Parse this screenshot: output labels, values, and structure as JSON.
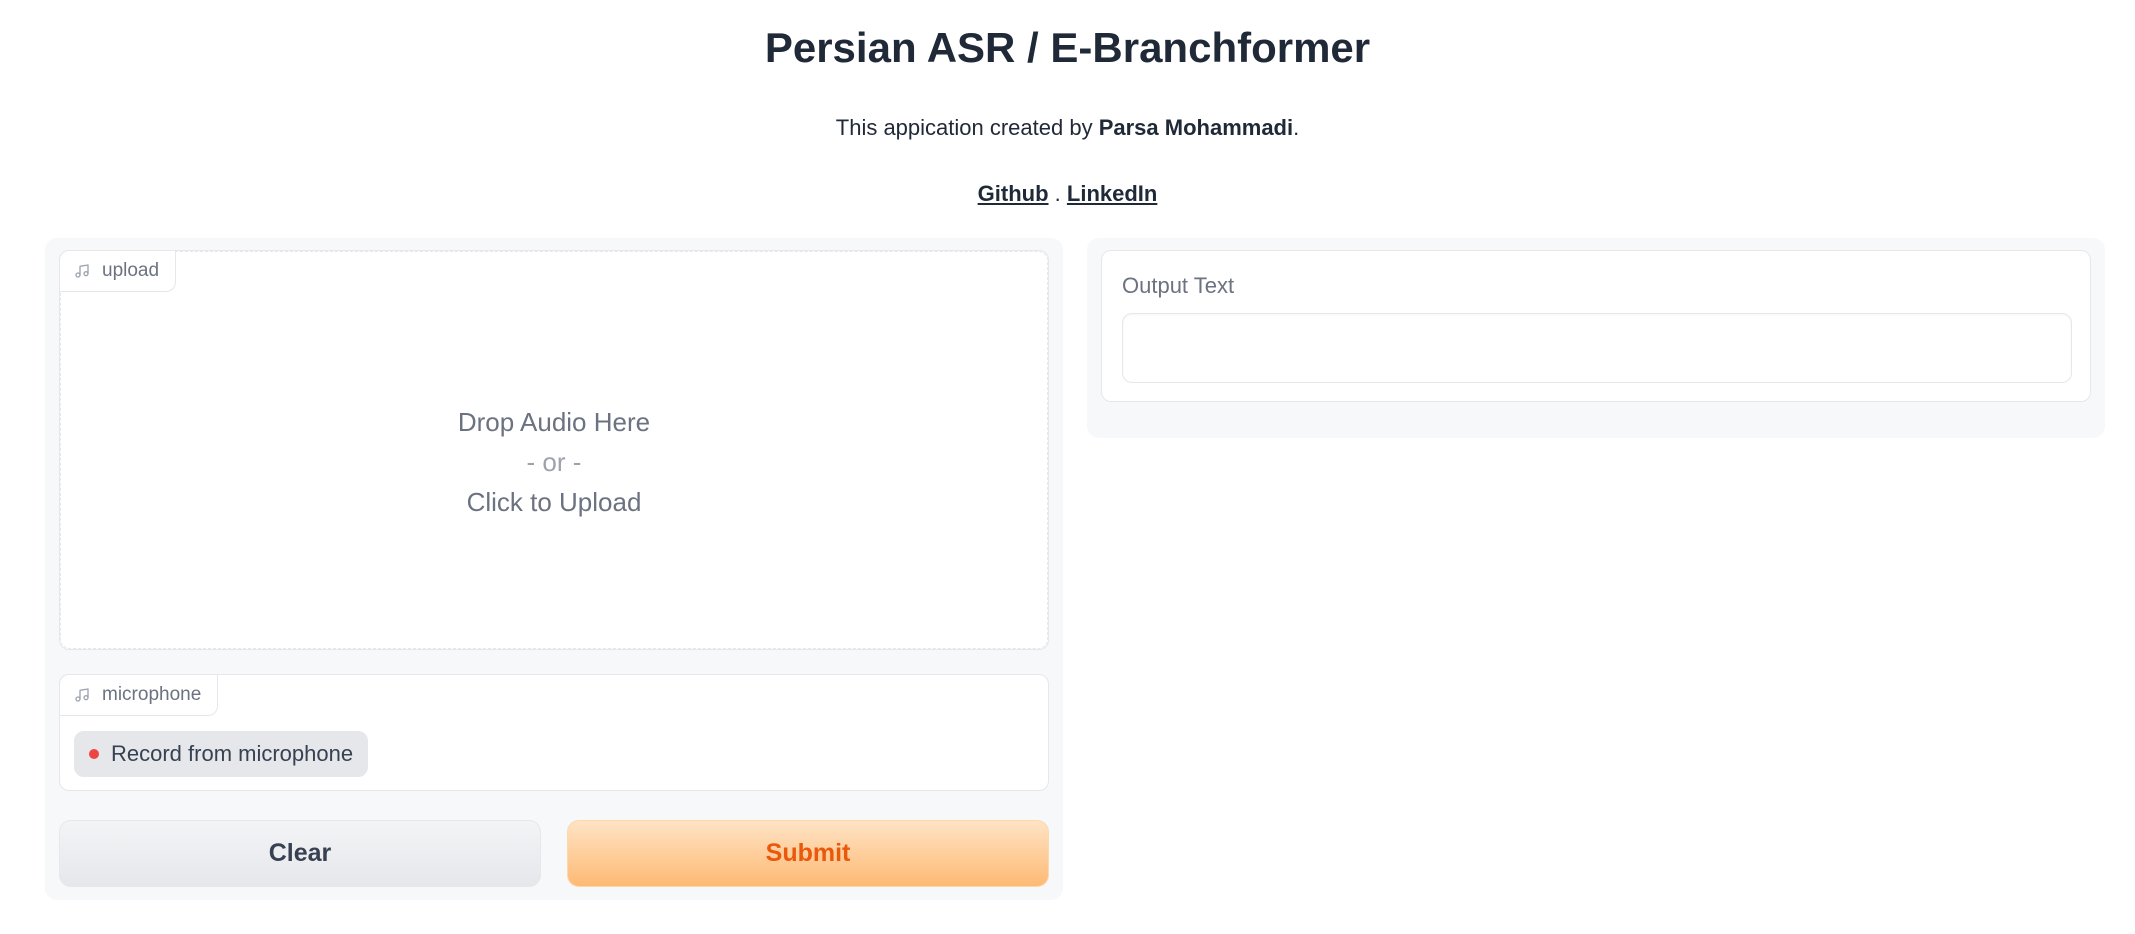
{
  "header": {
    "title": "Persian ASR / E-Branchformer",
    "description_prefix": "This appication created by ",
    "author": "Parsa Mohammadi",
    "description_suffix": ".",
    "links": {
      "github": "Github",
      "separator": ".",
      "linkedin": "LinkedIn"
    }
  },
  "inputs": {
    "upload": {
      "label": "upload",
      "icon": "music-note-icon",
      "drop_line1": "Drop Audio Here",
      "drop_line2": "- or -",
      "drop_line3": "Click to Upload"
    },
    "microphone": {
      "label": "microphone",
      "icon": "music-note-icon",
      "record_label": "Record from microphone"
    }
  },
  "actions": {
    "clear_label": "Clear",
    "submit_label": "Submit"
  },
  "output": {
    "label": "Output Text",
    "value": ""
  },
  "colors": {
    "submit_text": "#ea580c",
    "submit_bg_top": "#ffe3c5",
    "submit_bg_bottom": "#fdba74",
    "record_dot": "#ef4444"
  }
}
